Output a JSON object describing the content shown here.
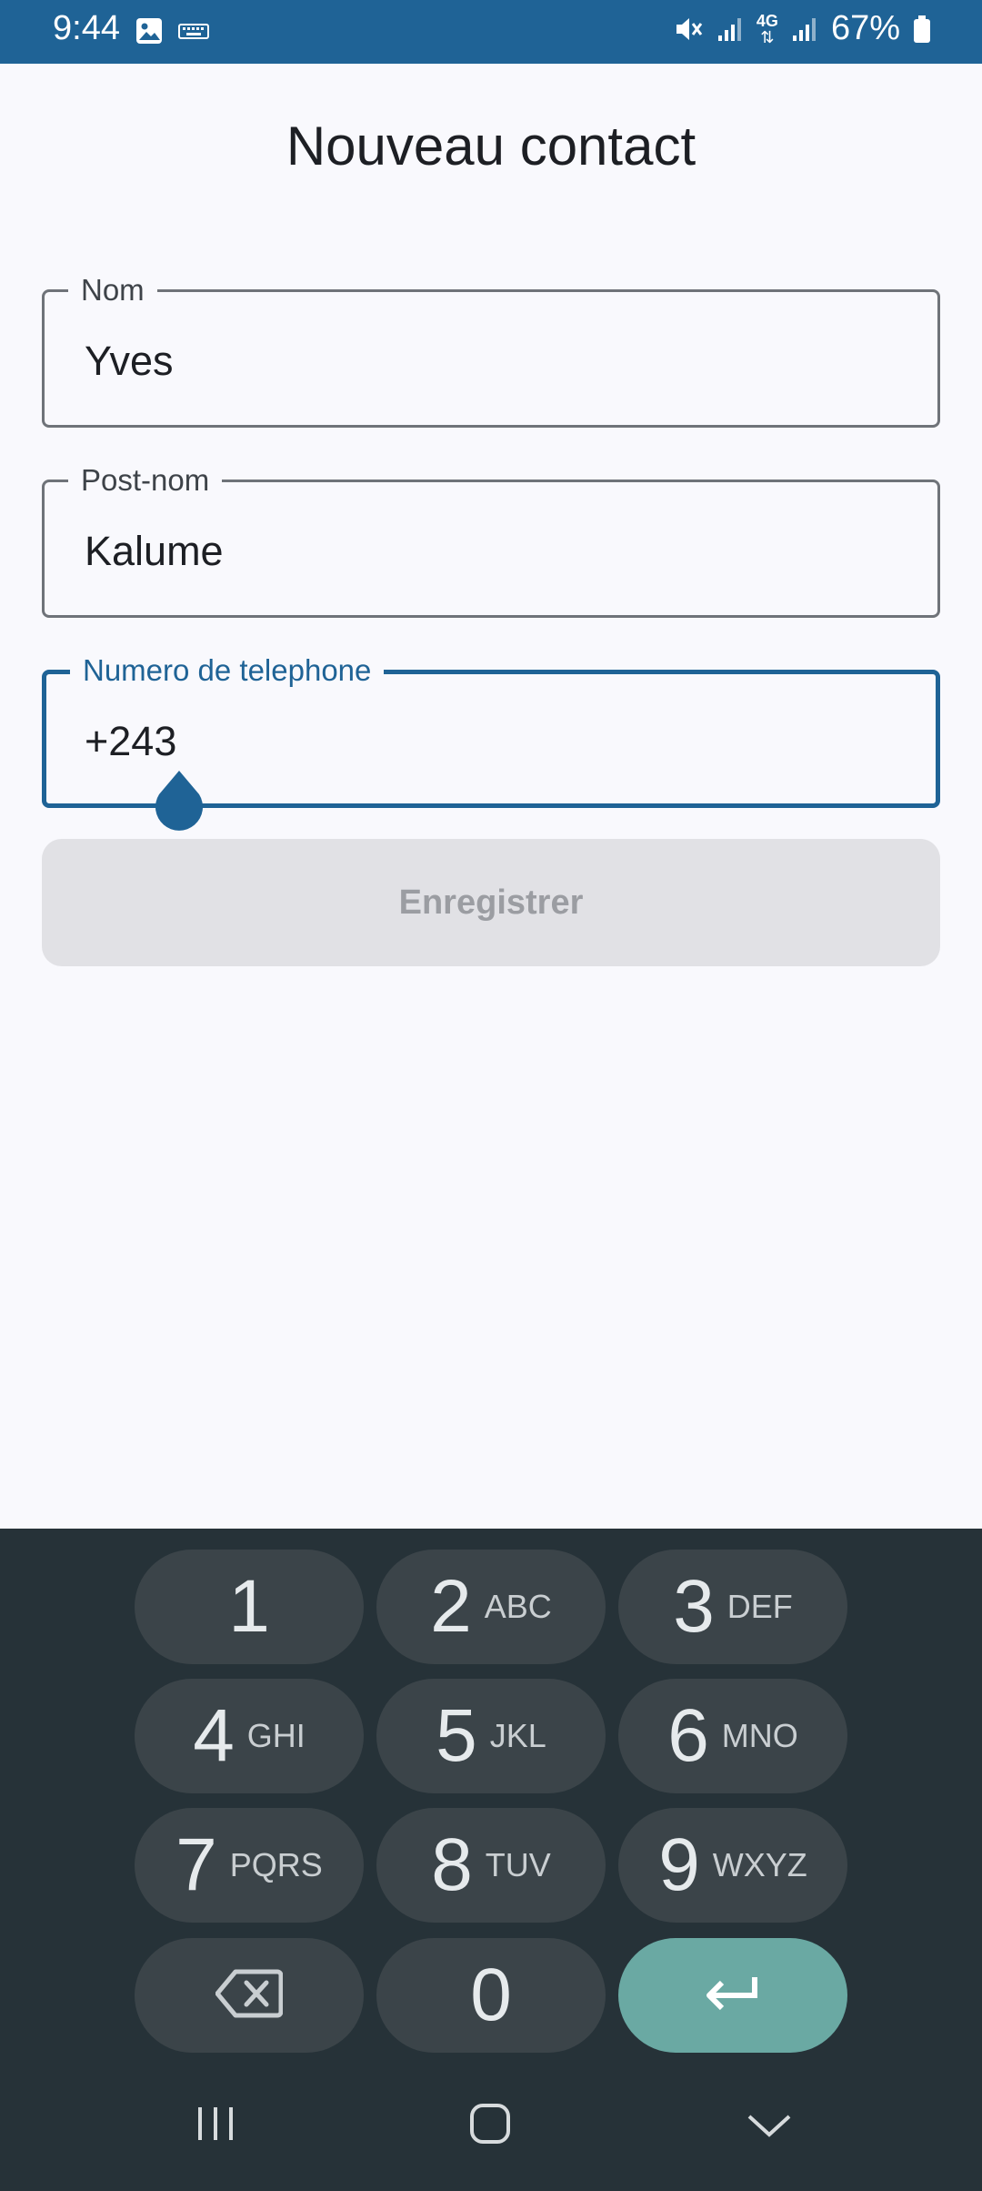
{
  "status_bar": {
    "time": "9:44",
    "battery": "67%",
    "network": "4G",
    "icons": [
      "image-icon",
      "keyboard-icon",
      "mute-icon",
      "signal-icon",
      "4g-icon",
      "signal-icon",
      "battery-icon"
    ]
  },
  "title": "Nouveau contact",
  "form": {
    "nom": {
      "label": "Nom",
      "value": "Yves"
    },
    "post_nom": {
      "label": "Post-nom",
      "value": "Kalume"
    },
    "telephone": {
      "label": "Numero de telephone",
      "value": "+243"
    }
  },
  "save_button": {
    "label": "Enregistrer"
  },
  "keypad": {
    "keys": [
      {
        "digit": "1",
        "letters": ""
      },
      {
        "digit": "2",
        "letters": "ABC"
      },
      {
        "digit": "3",
        "letters": "DEF"
      },
      {
        "digit": "4",
        "letters": "GHI"
      },
      {
        "digit": "5",
        "letters": "JKL"
      },
      {
        "digit": "6",
        "letters": "MNO"
      },
      {
        "digit": "7",
        "letters": "PQRS"
      },
      {
        "digit": "8",
        "letters": "TUV"
      },
      {
        "digit": "9",
        "letters": "WXYZ"
      },
      {
        "digit": "0",
        "letters": ""
      }
    ],
    "backspace_icon": "backspace-icon",
    "enter_icon": "enter-icon"
  },
  "nav": {
    "icons": [
      "recent-apps-icon",
      "home-icon",
      "hide-keyboard-icon"
    ]
  },
  "colors": {
    "primary": "#1f6396",
    "background": "#f9f9fd",
    "keypad": "#263238",
    "key": "#3b4449",
    "enter_key": "#6aa9a3",
    "disabled_button": "#e1e1e5"
  }
}
